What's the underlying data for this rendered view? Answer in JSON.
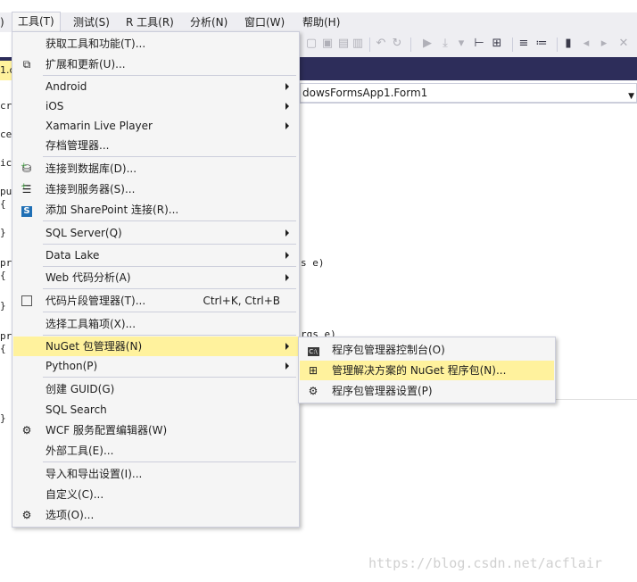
{
  "menubar": {
    "items": [
      {
        "label": ")"
      },
      {
        "label": "工具(T)"
      },
      {
        "label": "测试(S)"
      },
      {
        "label": "R 工具(R)"
      },
      {
        "label": "分析(N)"
      },
      {
        "label": "窗口(W)"
      },
      {
        "label": "帮助(H)"
      }
    ]
  },
  "tab_fragment": "1.c",
  "editor": {
    "nav_combo_value": "dowsFormsApp1.Form1",
    "left_gutter": [
      "cr",
      "ce",
      "ic",
      "pu",
      "{",
      "}",
      "pr",
      "{",
      "}",
      "pr",
      "{",
      "}"
    ],
    "code_fragment_1": "s e)",
    "code_fragment_2": "rgs e)"
  },
  "tools_menu": {
    "items": [
      {
        "label": "获取工具和功能(T)...",
        "icon": ""
      },
      {
        "label": "扩展和更新(U)...",
        "icon": "extensions-icon"
      },
      {
        "label": "Android",
        "submenu": true
      },
      {
        "label": "iOS",
        "submenu": true
      },
      {
        "label": "Xamarin Live Player",
        "submenu": true
      },
      {
        "label": "存档管理器...",
        "icon": ""
      },
      {
        "label": "连接到数据库(D)...",
        "icon": "connect-database-icon"
      },
      {
        "label": "连接到服务器(S)...",
        "icon": "connect-server-icon"
      },
      {
        "label": "添加 SharePoint 连接(R)...",
        "icon": "sharepoint-icon"
      },
      {
        "label": "SQL Server(Q)",
        "submenu": true
      },
      {
        "label": "Data Lake",
        "submenu": true
      },
      {
        "label": "Web 代码分析(A)",
        "submenu": true
      },
      {
        "label": "代码片段管理器(T)...",
        "icon": "snippet-icon",
        "shortcut": "Ctrl+K, Ctrl+B"
      },
      {
        "label": "选择工具箱项(X)..."
      },
      {
        "label": "NuGet 包管理器(N)",
        "submenu": true,
        "highlighted": true
      },
      {
        "label": "Python(P)",
        "submenu": true
      },
      {
        "label": "创建 GUID(G)"
      },
      {
        "label": "SQL Search"
      },
      {
        "label": "WCF 服务配置编辑器(W)",
        "icon": "wcf-config-icon"
      },
      {
        "label": "外部工具(E)..."
      },
      {
        "label": "导入和导出设置(I)..."
      },
      {
        "label": "自定义(C)..."
      },
      {
        "label": "选项(O)...",
        "icon": "gear-icon"
      }
    ]
  },
  "nuget_submenu": {
    "items": [
      {
        "label": "程序包管理器控制台(O)",
        "icon": "console-icon"
      },
      {
        "label": "管理解决方案的 NuGet 程序包(N)...",
        "icon": "package-icon",
        "highlighted": true
      },
      {
        "label": "程序包管理器设置(P)",
        "icon": "gear-icon"
      }
    ]
  },
  "watermark": "https://blog.csdn.net/acflair",
  "colors": {
    "menu_bg": "#f5f5f5",
    "highlight": "#fff29d",
    "menubar_bg": "#eeeef2",
    "tabstrip_bg": "#2d2d5a",
    "separator": "#cccedb"
  }
}
